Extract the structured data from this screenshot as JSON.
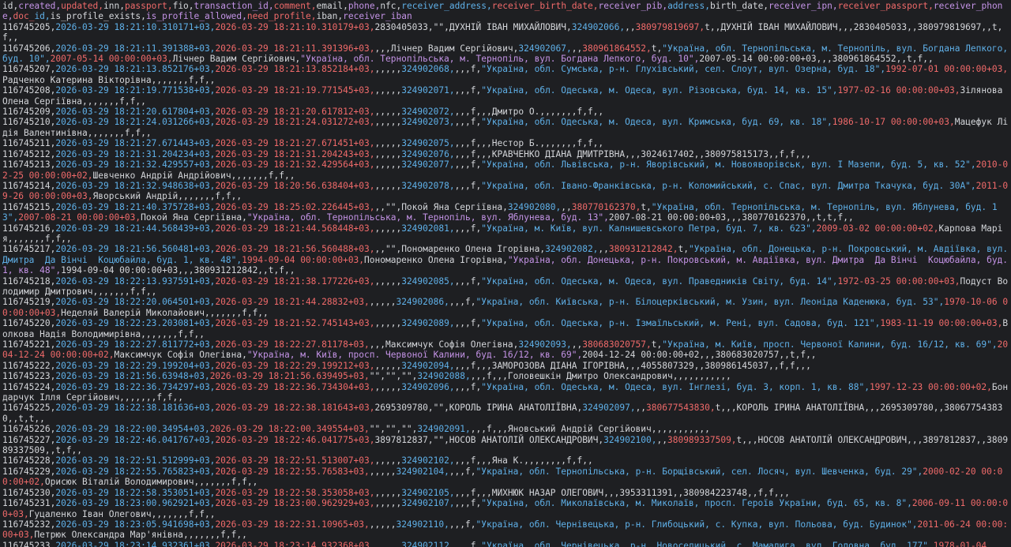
{
  "header": [
    [
      "id,",
      ""
    ],
    [
      "created,",
      "b"
    ],
    [
      "updated,",
      "c"
    ],
    [
      "inn,",
      ""
    ],
    [
      "passport,",
      "c"
    ],
    [
      "fio,",
      ""
    ],
    [
      "transaction_id,",
      "b"
    ],
    [
      "comment,",
      "c"
    ],
    [
      "email,",
      ""
    ],
    [
      "phone,",
      "b"
    ],
    [
      "nfc,",
      ""
    ],
    [
      "receiver_address,",
      "d"
    ],
    [
      "receiver_birth_date,",
      "c"
    ],
    [
      "receiver_pib,",
      "b"
    ],
    [
      "address,",
      "d"
    ],
    [
      "birth_date,",
      ""
    ],
    [
      "receiver_ipn,",
      "b"
    ],
    [
      "receiver_passport,",
      "c"
    ],
    [
      "receiver_phone,",
      "b"
    ],
    [
      "doc_",
      "c"
    ],
    [
      "id,",
      "d"
    ],
    [
      "is_profile_exists,",
      ""
    ],
    [
      "is_profile_allowed,",
      "b"
    ],
    [
      "need_profile,",
      "c"
    ],
    [
      "iban,",
      ""
    ],
    [
      "receiver_iban",
      "b"
    ]
  ],
  "rows": [
    [
      [
        "116745205,",
        "p"
      ],
      [
        "2026-03-29 18:21:10.310171+03,",
        "d"
      ],
      [
        "2026-03-29 18:21:10.310179+03,",
        "r"
      ],
      [
        "2830405033,\"\",",
        "p"
      ],
      [
        "ДУХНІЙ ІВАН МИХАЙЛОВИЧ,",
        "p"
      ],
      [
        "324902066,",
        "d"
      ],
      [
        ",,",
        "p"
      ],
      [
        "380979819697,",
        "r"
      ],
      [
        "t,,ДУХНІЙ ІВАН МИХАЙЛОВИЧ,,,2830405033,,380979819697,,t,f,,",
        "p"
      ]
    ],
    [
      [
        "116745206,",
        "p"
      ],
      [
        "2026-03-29 18:21:11.391388+03,",
        "d"
      ],
      [
        "2026-03-29 18:21:11.391396+03,",
        "r"
      ],
      [
        ",,,Лічнер Вадим Сергійович,",
        "p"
      ],
      [
        "324902067,",
        "d"
      ],
      [
        ",,",
        "p"
      ],
      [
        "380961864552,",
        "r"
      ],
      [
        "t,",
        "p"
      ],
      [
        "\"Україна, обл. Тернопільська, м. Тернопіль, вул. Богдана Лепкого, буд. 10\",",
        "d"
      ],
      [
        "2007-05-14 00:00:00+03,",
        "r"
      ],
      [
        "Лічнер Вадим Сергійович,",
        "p"
      ],
      [
        "\"Україна, обл. Тернопільська, м. Тернопіль, вул. Богдана Лепкого, буд. 10\",",
        "b"
      ],
      [
        "2007-05-14 00:00:00+03,,,380961864552,,t,f,,",
        "p"
      ]
    ],
    [
      [
        "116745207,",
        "p"
      ],
      [
        "2026-03-29 18:21:13.852176+03,",
        "d"
      ],
      [
        "2026-03-29 18:21:13.852184+03,",
        "r"
      ],
      [
        ",,,,,",
        "p"
      ],
      [
        "324902068,",
        "d"
      ],
      [
        ",,,f,",
        "p"
      ],
      [
        "\"Україна, обл. Сумська, р-н. Глухівський, сел. Слоут, вул. Озерна, буд. 18\",",
        "d"
      ],
      [
        "1992-07-01 00:00:00+03,",
        "r"
      ],
      [
        "Радченко Катерина Вікторівна,,,,,,,f,f,,",
        "p"
      ]
    ],
    [
      [
        "116745208,",
        "p"
      ],
      [
        "2026-03-29 18:21:19.771538+03,",
        "d"
      ],
      [
        "2026-03-29 18:21:19.771545+03,",
        "r"
      ],
      [
        ",,,,,",
        "p"
      ],
      [
        "324902071,",
        "d"
      ],
      [
        ",,,f,",
        "p"
      ],
      [
        "\"Україна, обл. Одеська, м. Одеса, вул. Різовська, буд. 14, кв. 15\",",
        "d"
      ],
      [
        "1977-02-16 00:00:00+03,",
        "r"
      ],
      [
        "Зілянова Олена Сергіївна,,,,,,,f,f,,",
        "p"
      ]
    ],
    [
      [
        "116745209,",
        "p"
      ],
      [
        "2026-03-29 18:21:20.617804+03,",
        "d"
      ],
      [
        "2026-03-29 18:21:20.617812+03,",
        "r"
      ],
      [
        ",,,,,",
        "p"
      ],
      [
        "324902072,",
        "d"
      ],
      [
        ",,,f,,,Дмитро О.,,,,,,,f,f,,",
        "p"
      ]
    ],
    [
      [
        "116745210,",
        "p"
      ],
      [
        "2026-03-29 18:21:24.031266+03,",
        "d"
      ],
      [
        "2026-03-29 18:21:24.031272+03,",
        "r"
      ],
      [
        ",,,,,",
        "p"
      ],
      [
        "324902073,",
        "d"
      ],
      [
        ",,,f,",
        "p"
      ],
      [
        "\"Україна, обл. Одеська, м. Одеса, вул. Кримська, буд. 69, кв. 18\",",
        "d"
      ],
      [
        "1986-10-17 00:00:00+03,",
        "r"
      ],
      [
        "Мацефук Лідія Валентинівна,,,,,,,f,f,,",
        "p"
      ]
    ],
    [
      [
        "116745211,",
        "p"
      ],
      [
        "2026-03-29 18:21:27.671443+03,",
        "d"
      ],
      [
        "2026-03-29 18:21:27.671451+03,",
        "r"
      ],
      [
        ",,,,,",
        "p"
      ],
      [
        "324902075,",
        "d"
      ],
      [
        ",,,f,,,Нестор Б.,,,,,,,f,f,,",
        "p"
      ]
    ],
    [
      [
        "116745212,",
        "p"
      ],
      [
        "2026-03-29 18:21:31.204234+03,",
        "d"
      ],
      [
        "2026-03-29 18:21:31.204243+03,",
        "r"
      ],
      [
        ",,,,,",
        "p"
      ],
      [
        "324902076,",
        "d"
      ],
      [
        ",,,f,,,КРАВЧЕНКО ДІАНА ДМИТРІВНА,,,3024617402,,380975815173,,f,f,,,",
        "p"
      ]
    ],
    [
      [
        "116745213,",
        "p"
      ],
      [
        "2026-03-29 18:21:32.429557+03,",
        "d"
      ],
      [
        "2026-03-29 18:21:32.429564+03,",
        "r"
      ],
      [
        ",,,,,",
        "p"
      ],
      [
        "324902077,",
        "d"
      ],
      [
        ",,,f,",
        "p"
      ],
      [
        "\"Україна, обл. Львівська, р-н. Яворівський, м. Новояворівськ, вул. І Мазепи, буд. 5, кв. 52\",",
        "d"
      ],
      [
        "2010-02-25 00:00:00+02,",
        "r"
      ],
      [
        "Шевченко Андрій Андрійович,,,,,,,f,f,,",
        "p"
      ]
    ],
    [
      [
        "116745214,",
        "p"
      ],
      [
        "2026-03-29 18:21:32.948638+03,",
        "d"
      ],
      [
        "2026-03-29 18:20:56.638404+03,",
        "r"
      ],
      [
        ",,,,,",
        "p"
      ],
      [
        "324902078,",
        "d"
      ],
      [
        ",,,f,",
        "p"
      ],
      [
        "\"Україна, обл. Івано-Франківська, р-н. Коломийський, с. Спас, вул. Дмитра Ткачука, буд. 30А\",",
        "d"
      ],
      [
        "2011-09-26 00:00:00+03,",
        "r"
      ],
      [
        "Яворський Андрій,,,,,,,f,f,,",
        "p"
      ]
    ],
    [
      [
        "116745215,",
        "p"
      ],
      [
        "2026-03-29 18:21:40.375728+03,",
        "d"
      ],
      [
        "2026-03-29 18:25:02.226445+03,",
        "r"
      ],
      [
        ",,\"\",Покой Яна Сергіївна,",
        "p"
      ],
      [
        "324902080,",
        "d"
      ],
      [
        ",,",
        "p"
      ],
      [
        "380770162370,",
        "r"
      ],
      [
        "t,",
        "p"
      ],
      [
        "\"Україна, обл. Тернопільська, м. Тернопіль, вул. Яблунева, буд. 13\",",
        "d"
      ],
      [
        "2007-08-21 00:00:00+03,",
        "r"
      ],
      [
        "Покой Яна Сергіївна,",
        "p"
      ],
      [
        "\"Україна, обл. Тернопільська, м. Тернопіль, вул. Яблунева, буд. 13\",",
        "b"
      ],
      [
        "2007-08-21 00:00:00+03,,,380770162370,,t,t,f,,",
        "p"
      ]
    ],
    [
      [
        "116745216,",
        "p"
      ],
      [
        "2026-03-29 18:21:44.568439+03,",
        "d"
      ],
      [
        "2026-03-29 18:21:44.568448+03,",
        "r"
      ],
      [
        ",,,,,",
        "p"
      ],
      [
        "324902081,",
        "d"
      ],
      [
        ",,,f,",
        "p"
      ],
      [
        "\"Україна, м. Київ, вул. Калнишевського Петра, буд. 7, кв. 623\",",
        "d"
      ],
      [
        "2009-03-02 00:00:00+02,",
        "r"
      ],
      [
        "Карпова Марія,,,,,,,f,f,,",
        "p"
      ]
    ],
    [
      [
        "116745217,",
        "p"
      ],
      [
        "2026-03-29 18:21:56.560481+03,",
        "d"
      ],
      [
        "2026-03-29 18:21:56.560488+03,",
        "r"
      ],
      [
        ",,\"\",Пономаренко Олена Ігорівна,",
        "p"
      ],
      [
        "324902082,",
        "d"
      ],
      [
        ",,",
        "p"
      ],
      [
        "380931212842,",
        "r"
      ],
      [
        "t,",
        "p"
      ],
      [
        "\"Україна, обл. Донецька, р-н. Покровський, м. Авдіївка, вул. Дмитра  Да Вінчі  Коцюбайла, буд. 1, кв. 48\",",
        "d"
      ],
      [
        "1994-09-04 00:00:00+03,",
        "r"
      ],
      [
        "Пономаренко Олена Ігорівна,",
        "p"
      ],
      [
        "\"Україна, обл. Донецька, р-н. Покровський, м. Авдіївка, вул. Дмитра  Да Вінчі  Коцюбайла, буд. 1, кв. 48\",",
        "b"
      ],
      [
        "1994-09-04 00:00:00+03,,,380931212842,,t,f,,",
        "p"
      ]
    ],
    [
      [
        "116745218,",
        "p"
      ],
      [
        "2026-03-29 18:22:13.937591+03,",
        "d"
      ],
      [
        "2026-03-29 18:21:38.177226+03,",
        "r"
      ],
      [
        ",,,,,",
        "p"
      ],
      [
        "324902085,",
        "d"
      ],
      [
        ",,,f,",
        "p"
      ],
      [
        "\"Україна, обл. Одеська, м. Одеса, вул. Праведників Світу, буд. 14\",",
        "d"
      ],
      [
        "1972-03-25 00:00:00+03,",
        "r"
      ],
      [
        "Подуст Володимир Дмитрович,,,,,,,f,f,,",
        "p"
      ]
    ],
    [
      [
        "116745219,",
        "p"
      ],
      [
        "2026-03-29 18:22:20.064501+03,",
        "d"
      ],
      [
        "2026-03-29 18:21:44.28832+03,",
        "r"
      ],
      [
        ",,,,,",
        "p"
      ],
      [
        "324902086,",
        "d"
      ],
      [
        ",,,f,",
        "p"
      ],
      [
        "\"Україна, обл. Київська, р-н. Білоцерківський, м. Узин, вул. Леоніда Каденюка, буд. 53\",",
        "d"
      ],
      [
        "1970-10-06 00:00:00+03,",
        "r"
      ],
      [
        "Неделяй Валерій Миколайович,,,,,,,f,f,,",
        "p"
      ]
    ],
    [
      [
        "116745220,",
        "p"
      ],
      [
        "2026-03-29 18:22:23.203081+03,",
        "d"
      ],
      [
        "2026-03-29 18:21:52.745143+03,",
        "r"
      ],
      [
        ",,,,,",
        "p"
      ],
      [
        "324902089,",
        "d"
      ],
      [
        ",,,f,",
        "p"
      ],
      [
        "\"Україна, обл. Одеська, р-н. Ізмаїльський, м. Рені, вул. Садова, буд. 121\",",
        "d"
      ],
      [
        "1983-11-19 00:00:00+03,",
        "r"
      ],
      [
        "Волкова Надія Володимирівна,,,,,,,f,f,,",
        "p"
      ]
    ],
    [
      [
        "116745221,",
        "p"
      ],
      [
        "2026-03-29 18:22:27.811772+03,",
        "d"
      ],
      [
        "2026-03-29 18:22:27.81178+03,",
        "r"
      ],
      [
        ",,,Максимчук Софія Олегівна,",
        "p"
      ],
      [
        "324902093,",
        "d"
      ],
      [
        ",,",
        "p"
      ],
      [
        "380683020757,",
        "r"
      ],
      [
        "t,",
        "p"
      ],
      [
        "\"Україна, м. Київ, просп. Червоної Калини, буд. 16/12, кв. 69\",",
        "d"
      ],
      [
        "2004-12-24 00:00:00+02,",
        "r"
      ],
      [
        "Максимчук Софія Олегівна,",
        "p"
      ],
      [
        "\"Україна, м. Київ, просп. Червоної Калини, буд. 16/12, кв. 69\",",
        "b"
      ],
      [
        "2004-12-24 00:00:00+02,,,380683020757,,t,f,,",
        "p"
      ]
    ],
    [
      [
        "116745222,",
        "p"
      ],
      [
        "2026-03-29 18:22:29.199204+03,",
        "d"
      ],
      [
        "2026-03-29 18:22:29.199212+03,",
        "r"
      ],
      [
        ",,,,,",
        "p"
      ],
      [
        "324902094,",
        "d"
      ],
      [
        ",,,f,,,ЗАМОРОЗОВА ДІАНА ІГОРІВНА,,,4055807329,,380986145037,,f,f,,,",
        "p"
      ]
    ],
    [
      [
        "116745223,",
        "p"
      ],
      [
        "2026-03-29 18:21:56.63948+03,",
        "d"
      ],
      [
        "2026-03-29 18:21:56.639495+03,",
        "r"
      ],
      [
        "\"\",\"\",\"\",",
        "p"
      ],
      [
        "324902088,",
        "d"
      ],
      [
        ",,,f,,,Головешкін Дмитро Олександрович,,,,,,,,,,,",
        "p"
      ]
    ],
    [
      [
        "116745224,",
        "p"
      ],
      [
        "2026-03-29 18:22:36.734297+03,",
        "d"
      ],
      [
        "2026-03-29 18:22:36.734304+03,",
        "r"
      ],
      [
        ",,,,,",
        "p"
      ],
      [
        "324902096,",
        "d"
      ],
      [
        ",,,f,",
        "p"
      ],
      [
        "\"Україна, обл. Одеська, м. Одеса, вул. Інглезі, буд. 3, корп. 1, кв. 88\",",
        "d"
      ],
      [
        "1997-12-23 00:00:00+02,",
        "r"
      ],
      [
        "Бондарчук Ілля Сергійович,,,,,,,f,f,,",
        "p"
      ]
    ],
    [
      [
        "116745225,",
        "p"
      ],
      [
        "2026-03-29 18:22:38.181636+03,",
        "d"
      ],
      [
        "2026-03-29 18:22:38.181643+03,",
        "r"
      ],
      [
        "2695309780,\"\",КОРОЛЬ ІРИНА АНАТОЛІЇВНА,",
        "p"
      ],
      [
        "324902097,",
        "d"
      ],
      [
        ",,",
        "p"
      ],
      [
        "380677543830,",
        "r"
      ],
      [
        "t,,,КОРОЛЬ ІРИНА АНАТОЛІЇВНА,,,2695309780,,380677543830,,t,t,,",
        "p"
      ]
    ],
    [
      [
        "116745226,",
        "p"
      ],
      [
        "2026-03-29 18:22:00.34954+03,",
        "d"
      ],
      [
        "2026-03-29 18:22:00.349554+03,",
        "r"
      ],
      [
        "\"\",\"\",\"\",",
        "p"
      ],
      [
        "324902091,",
        "d"
      ],
      [
        ",,,f,,,Яновський Андрій Сергійович,,,,,,,,,,,",
        "p"
      ]
    ],
    [
      [
        "116745227,",
        "p"
      ],
      [
        "2026-03-29 18:22:46.041767+03,",
        "d"
      ],
      [
        "2026-03-29 18:22:46.041775+03,",
        "r"
      ],
      [
        "3897812837,\"\",НОСОВ АНАТОЛІЙ ОЛЕКСАНДРОВИЧ,",
        "p"
      ],
      [
        "324902100,",
        "d"
      ],
      [
        ",,",
        "p"
      ],
      [
        "380989337509,",
        "r"
      ],
      [
        "t,,,НОСОВ АНАТОЛІЙ ОЛЕКСАНДРОВИЧ,,,3897812837,,380989337509,,t,f,,",
        "p"
      ]
    ],
    [
      [
        "116745228,",
        "p"
      ],
      [
        "2026-03-29 18:22:51.512999+03,",
        "d"
      ],
      [
        "2026-03-29 18:22:51.513007+03,",
        "r"
      ],
      [
        ",,,,,",
        "p"
      ],
      [
        "324902102,",
        "d"
      ],
      [
        ",,,f,,,Яна К.,,,,,,,,f,f,,",
        "p"
      ]
    ],
    [
      [
        "116745229,",
        "p"
      ],
      [
        "2026-03-29 18:22:55.765823+03,",
        "d"
      ],
      [
        "2026-03-29 18:22:55.76583+03,",
        "r"
      ],
      [
        ",,,,,",
        "p"
      ],
      [
        "324902104,",
        "d"
      ],
      [
        ",,,f,",
        "p"
      ],
      [
        "\"Україна, обл. Тернопільська, р-н. Борщівський, сел. Лосяч, вул. Шевченка, буд. 29\",",
        "d"
      ],
      [
        "2000-02-20 00:00:00+02,",
        "r"
      ],
      [
        "Орисюк Віталій Володимирович,,,,,,,f,f,,",
        "p"
      ]
    ],
    [
      [
        "116745230,",
        "p"
      ],
      [
        "2026-03-29 18:22:58.353051+03,",
        "d"
      ],
      [
        "2026-03-29 18:22:58.353058+03,",
        "r"
      ],
      [
        ",,,,,",
        "p"
      ],
      [
        "324902105,",
        "d"
      ],
      [
        ",,,f,,,МИХНЮК НАЗАР ОЛЕГОВИЧ,,,3953311391,,380984223748,,f,f,,,",
        "p"
      ]
    ],
    [
      [
        "116745231,",
        "p"
      ],
      [
        "2026-03-29 18:23:00.962921+03,",
        "d"
      ],
      [
        "2026-03-29 18:23:00.962929+03,",
        "r"
      ],
      [
        ",,,,,",
        "p"
      ],
      [
        "324902107,",
        "d"
      ],
      [
        ",,,f,",
        "p"
      ],
      [
        "\"Україна, обл. Миколаївська, м. Миколаїв, просп. Героїв України, буд. 65, кв. 8\",",
        "d"
      ],
      [
        "2006-09-11 00:00:00+03,",
        "r"
      ],
      [
        "Гуцаленко Іван Олегович,,,,,,,f,f,,",
        "p"
      ]
    ],
    [
      [
        "116745232,",
        "p"
      ],
      [
        "2026-03-29 18:23:05.941698+03,",
        "d"
      ],
      [
        "2026-03-29 18:22:31.10965+03,",
        "r"
      ],
      [
        ",,,,,",
        "p"
      ],
      [
        "324902110,",
        "d"
      ],
      [
        ",,,f,",
        "p"
      ],
      [
        "\"Україна, обл. Чернівецька, р-н. Глибоцький, с. Купка, вул. Польова, буд. Будинок\",",
        "d"
      ],
      [
        "2011-06-24 00:00:00+03,",
        "r"
      ],
      [
        "Петрюк Олександра Мар'янівна,,,,,,,f,f,,",
        "p"
      ]
    ],
    [
      [
        "116745233,",
        "p"
      ],
      [
        "2026-03-29 18:23:14.932361+03,",
        "d"
      ],
      [
        "2026-03-29 18:23:14.932368+03,",
        "r"
      ],
      [
        ",,,,,",
        "p"
      ],
      [
        "324902112,",
        "d"
      ],
      [
        ",,,f,",
        "p"
      ],
      [
        "\"Україна, обл. Чернівецька, р-н. Новоселицький, с. Мамалига, вул. Головна, буд. 177\",",
        "d"
      ],
      [
        "1978-01-04",
        "r"
      ]
    ]
  ]
}
